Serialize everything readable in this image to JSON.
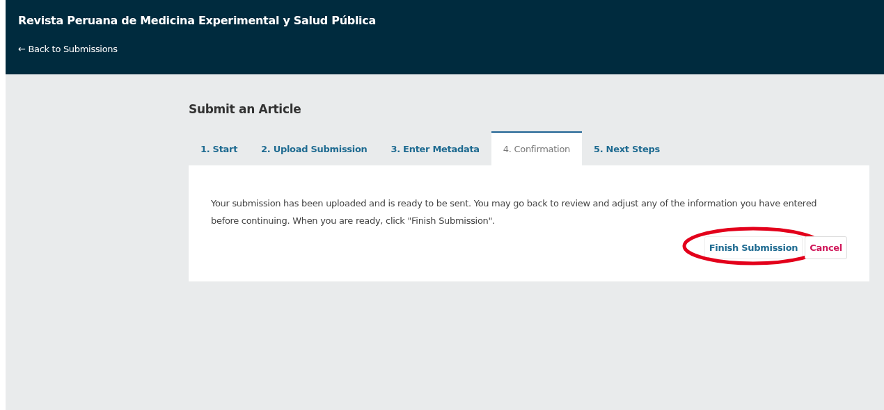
{
  "header": {
    "title": "Revista Peruana de Medicina Experimental y Salud Pública",
    "back_link": "← Back to Submissions"
  },
  "page_title": "Submit an Article",
  "tabs": [
    {
      "label": "1. Start",
      "selected": false
    },
    {
      "label": "2. Upload Submission",
      "selected": false
    },
    {
      "label": "3. Enter Metadata",
      "selected": false
    },
    {
      "label": "4. Confirmation",
      "selected": true
    },
    {
      "label": "5. Next Steps",
      "selected": false
    }
  ],
  "message": "Your submission has been uploaded and is ready to be sent. You may go back to review and adjust any of the information you have entered before continuing. When you are ready, click \"Finish Submission\".",
  "buttons": [
    {
      "label": "Finish Submission",
      "kind": "primary",
      "circled": true
    },
    {
      "label": "Cancel",
      "kind": "cancel",
      "circled": false
    }
  ]
}
